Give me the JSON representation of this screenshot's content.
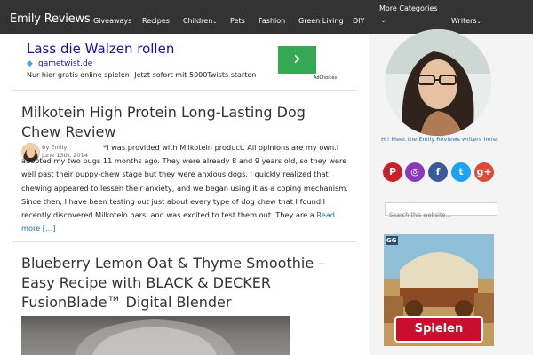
{
  "header": {
    "brand": "Emily Reviews",
    "nav": [
      {
        "label": "Giveaways",
        "caret": ""
      },
      {
        "label": "Recipes",
        "caret": ""
      },
      {
        "label": "Children",
        "caret": "⌄"
      },
      {
        "label": "Pets",
        "caret": ""
      },
      {
        "label": "Fashion",
        "caret": ""
      },
      {
        "label": "Green Living",
        "caret": ""
      },
      {
        "label": "DIY",
        "caret": ""
      },
      {
        "label": "More Categories",
        "caret": "⌄"
      },
      {
        "label": "Writers",
        "caret": "⌄"
      }
    ]
  },
  "ad": {
    "title": "Lass die Walzen rollen",
    "url": "gametwist.de",
    "description": "Nur hier gratis online spielen- Jetzt sofort mit 5000Twists starten",
    "button_icon": "chevron-right-icon",
    "adchoices": "AdChoices"
  },
  "posts": [
    {
      "title": "Milkotein High Protein Long-Lasting Dog Chew Review",
      "author": "By Emily",
      "date": "June 13th, 2014",
      "excerpt": "*I was provided with Milkotein product. All opinions are my own.I adopted my two pugs 11 months ago. They were already 8 and 9 years old, so they were well past their puppy-chew stage but they were anxious dogs. I quickly realized that chewing appeared to lessen their anxiety, and we began using it as a coping mechanism. Since then, I have been testing out just about every type of dog chew that I found.I recently discovered Milkotein bars, and was excited to test them out. They are a",
      "read_more": "Read more […]"
    },
    {
      "title": "Blueberry Lemon Oat & Thyme Smoothie – Easy Recipe with BLACK & DECKER FusionBlade™ Digital Blender"
    }
  ],
  "sidebar": {
    "meet_text": "Hi! Meet the Emily Reviews writers here.",
    "social": [
      {
        "name": "pinterest-icon",
        "glyph": "P",
        "color": "#cb2027"
      },
      {
        "name": "instagram-icon",
        "glyph": "◎",
        "color": "#8a3ab9"
      },
      {
        "name": "facebook-icon",
        "glyph": "f",
        "color": "#3b5998"
      },
      {
        "name": "twitter-icon",
        "glyph": "t",
        "color": "#1da1f2"
      },
      {
        "name": "google-plus-icon",
        "glyph": "g+",
        "color": "#dd4b39"
      }
    ],
    "search_placeholder": "Search this website…",
    "game_ad": {
      "logo": "GG",
      "button": "Spielen"
    }
  }
}
